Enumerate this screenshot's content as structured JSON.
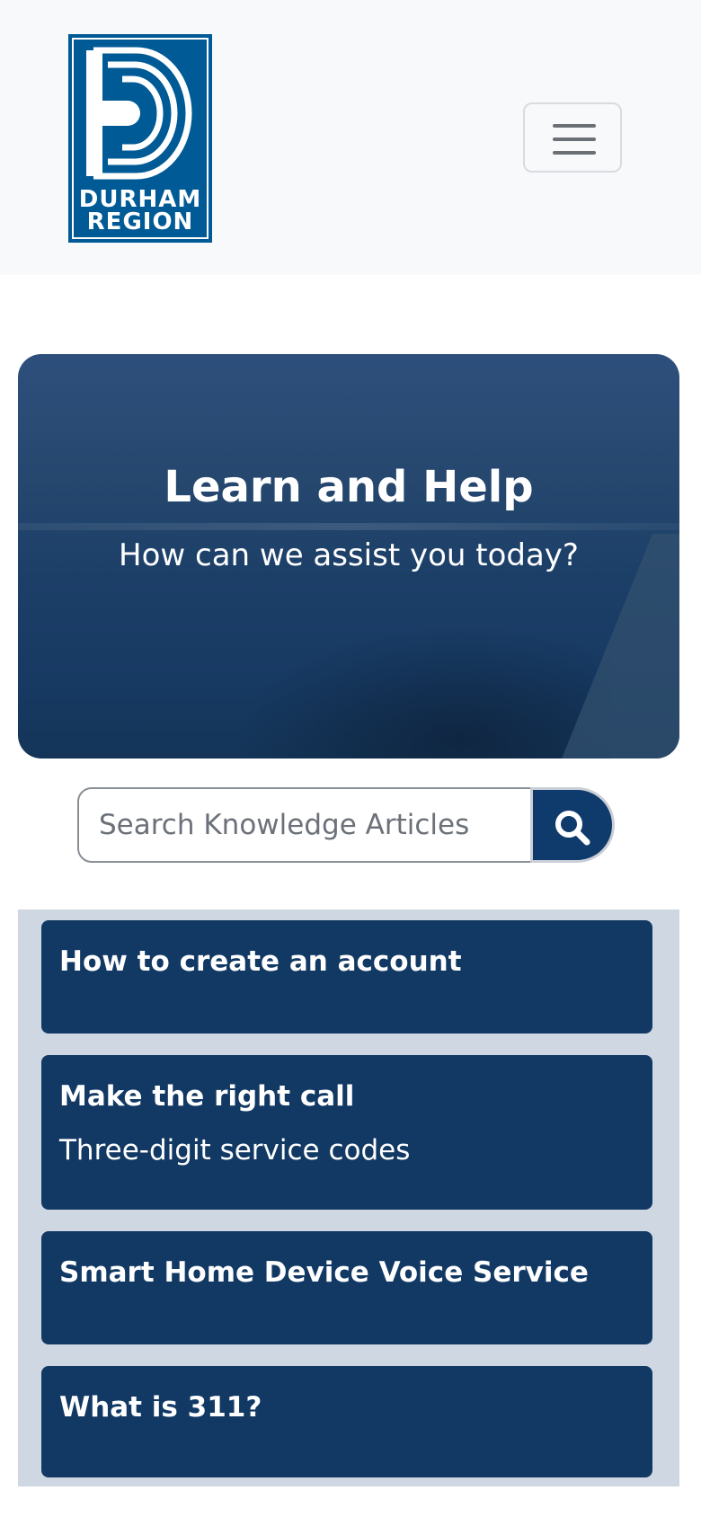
{
  "header": {
    "logo": {
      "line1": "DURHAM",
      "line2": "REGION"
    },
    "menu_button_icon": "hamburger-icon"
  },
  "hero": {
    "title": "Learn and Help",
    "subtitle": "How can we assist you today?"
  },
  "search": {
    "placeholder": "Search Knowledge Articles",
    "button_icon": "search-icon"
  },
  "articles": [
    {
      "title": "How to create an account",
      "subtitle": ""
    },
    {
      "title": "Make the right call",
      "subtitle": "Three-digit service codes"
    },
    {
      "title": "Smart Home Device Voice Service",
      "subtitle": ""
    },
    {
      "title": "What is 311?",
      "subtitle": ""
    }
  ],
  "colors": {
    "brand_blue": "#005a96",
    "card_navy": "#123964",
    "search_button": "#0f3a6c",
    "cards_background": "#cfd8e2"
  }
}
